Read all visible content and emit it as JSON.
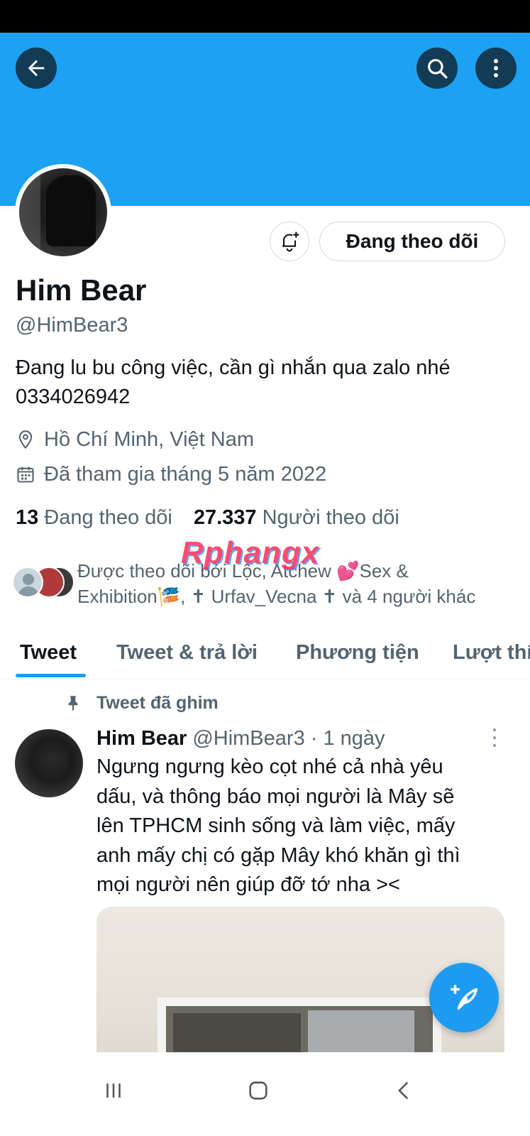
{
  "header": {
    "back_icon": "arrow-left-icon",
    "search_icon": "search-icon",
    "more_icon": "more-vertical-icon",
    "banner_color": "#1da1f2"
  },
  "profile": {
    "display_name": "Him Bear",
    "handle": "@HimBear3",
    "bio_line1": "Đang lu bu công việc, cần gì nhắn qua zalo nhé",
    "bio_line2": "0334026942",
    "location": "Hồ Chí Minh, Việt Nam",
    "joined": "Đã tham gia tháng 5 năm 2022",
    "following_count": "13",
    "following_label": "Đang theo dõi",
    "followers_count": "27.337",
    "followers_label": "Người theo dõi",
    "followed_by_line1": "Được theo dõi bởi Lộc, Atchew 💕Sex &",
    "followed_by_line2": "Exhibition🎏, ✝ Urfav_Vecna ✝ và 4 người khác"
  },
  "actions": {
    "notify_icon": "bell-plus-icon",
    "following_button": "Đang theo dõi"
  },
  "watermark": "Rphangx",
  "tabs": [
    {
      "label": "Tweet",
      "active": true
    },
    {
      "label": "Tweet & trả lời",
      "active": false
    },
    {
      "label": "Phương tiện",
      "active": false
    },
    {
      "label": "Lượt thích",
      "active": false
    }
  ],
  "tweet": {
    "pinned_label": "Tweet đã ghim",
    "author_name": "Him Bear",
    "author_handle": "@HimBear3 · 1 ngày",
    "text_lines": [
      "Ngưng ngưng kèo cọt nhé cả nhà yêu",
      "dấu, và thông báo mọi người là Mây sẽ",
      "lên TPHCM sinh sống và làm việc, mấy",
      "anh mấy chị có gặp Mây khó khăn gì thì",
      "mọi người nên giúp đỡ tớ nha ><"
    ]
  },
  "fab": {
    "icon": "compose-tweet-icon",
    "color": "#1d9bf0"
  },
  "accent_color": "#1d9bf0"
}
